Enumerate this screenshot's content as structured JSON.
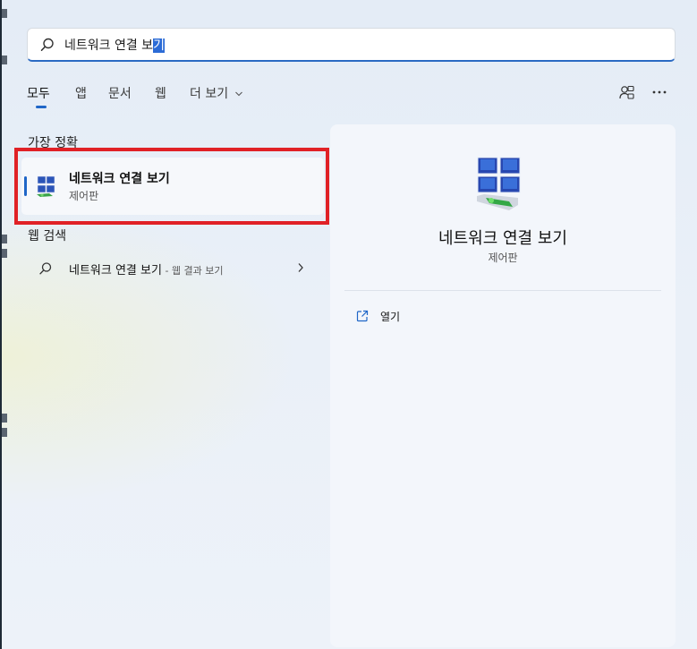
{
  "search": {
    "query_prefix": "네트워크 연결 보",
    "query_selected": "기"
  },
  "tabs": [
    {
      "label": "모두",
      "active": true
    },
    {
      "label": "앱"
    },
    {
      "label": "문서"
    },
    {
      "label": "웹"
    },
    {
      "label": "더 보기"
    }
  ],
  "best_match": {
    "section_label": "가장 정확",
    "name": "네트워크 연결 보기",
    "category": "제어판"
  },
  "web_search": {
    "section_label": "웹 검색",
    "query": "네트워크 연결 보기",
    "hint": " - 웹 결과 보기"
  },
  "detail": {
    "title": "네트워크 연결 보기",
    "subtitle": "제어판",
    "actions": [
      {
        "label": "열기",
        "icon": "open-external-icon"
      }
    ]
  },
  "colors": {
    "accent": "#1f66c7",
    "highlight": "#e02126"
  }
}
